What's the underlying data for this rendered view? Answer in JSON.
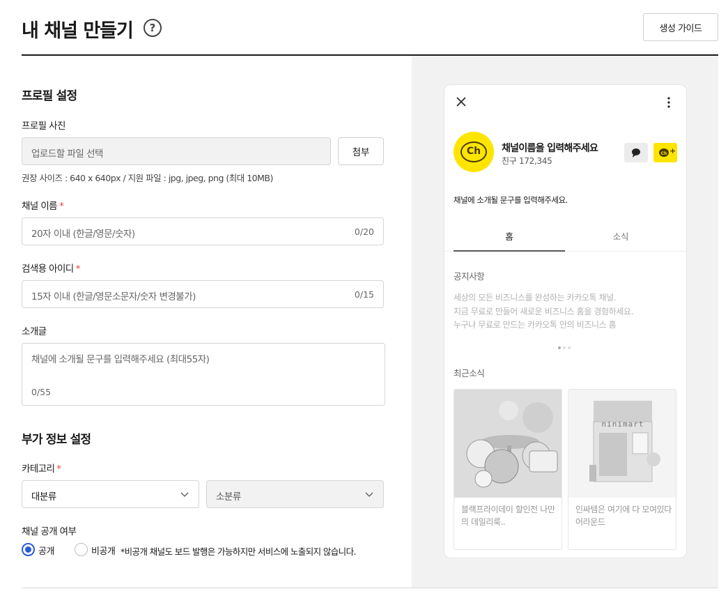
{
  "header": {
    "title": "내 채널 만들기",
    "help_glyph": "?",
    "guide_button": "생성 가이드"
  },
  "profile": {
    "section_title": "프로필 설정",
    "photo_label": "프로필 사진",
    "file_placeholder": "업로드할 파일 선택",
    "attach_button": "첨부",
    "hint": "권장 사이즈 : 640 x 640px / 지원 파일 : jpg, jpeg, png (최대 10MB)",
    "name_label": "채널 이름",
    "name_placeholder": "20자 이내 (한글/영문/숫자)",
    "name_count": "0/20",
    "search_id_label": "검색용 아이디",
    "search_id_placeholder": "15자 이내 (한글/영문소문자/숫자 변경불가)",
    "search_id_count": "0/15",
    "intro_label": "소개글",
    "intro_placeholder": "채널에 소개될 문구를 입력해주세요 (최대55자)",
    "intro_count": "0/55",
    "required_mark": "*"
  },
  "extra": {
    "section_title": "부가 정보 설정",
    "category_label": "카테고리",
    "category_main": "대분류",
    "category_sub": "소분류",
    "visibility_label": "채널 공개 여부",
    "public_label": "공개",
    "private_label": "비공개",
    "private_note": "*비공개 채널도 보드 발행은 가능하지만 서비스에 노출되지 않습니다.",
    "selected": "public"
  },
  "preview": {
    "logo_text": "Ch",
    "channel_name": "채널이름을 입력해주세요",
    "friends": "친구 172,345",
    "add_badge": "+",
    "description": "채널에 소개될 문구를 입력해주세요.",
    "tab_home": "홈",
    "tab_news": "소식",
    "notice_title": "공지사항",
    "notice_lines": [
      "세상의 모든 비즈니스를 완성하는 카카오톡 채널.",
      "지금 무료로 만들어 새로운 비즈니스 홈을 경험하세요.",
      "누구나 무료로 만드는 카카오톡 안의 비즈니스 홈"
    ],
    "recent_title": "최근소식",
    "cards": [
      {
        "caption": "블랙프라이데이 할인전 나만의 데일리룩.."
      },
      {
        "caption": "인싸템은 여기에 다 모여있다 어라운드",
        "sign": "ninimart"
      }
    ]
  },
  "colors": {
    "accent": "#2a5bd7",
    "kakao_yellow": "#fee500",
    "required": "#e54040"
  }
}
